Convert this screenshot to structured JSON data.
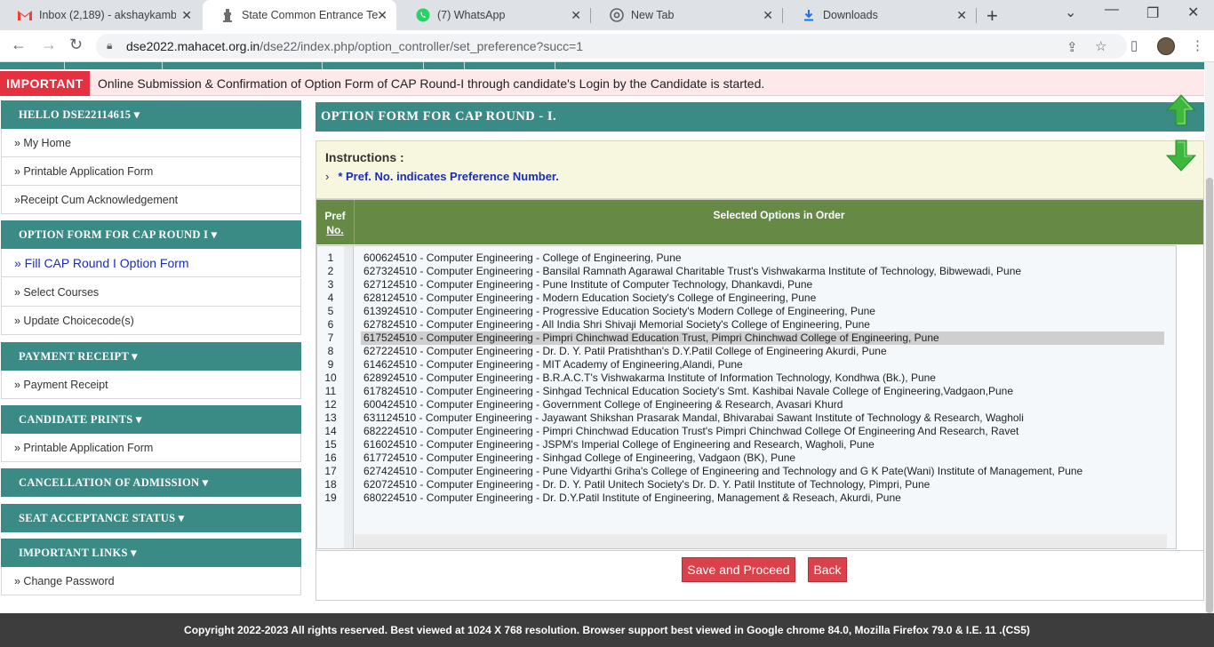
{
  "browser": {
    "tabs": [
      {
        "label": "Inbox (2,189) - akshaykamble",
        "icon": "gmail-icon",
        "active": false
      },
      {
        "label": "State Common Entrance Test",
        "icon": "emblem-icon",
        "active": true
      },
      {
        "label": "(7) WhatsApp",
        "icon": "whatsapp-icon",
        "active": false
      },
      {
        "label": "New Tab",
        "icon": "chrome-icon",
        "active": false
      },
      {
        "label": "Downloads",
        "icon": "download-icon",
        "active": false
      }
    ],
    "url_host": "dse2022.mahacet.org.in",
    "url_path": "/dse22/index.php/option_controller/set_preference?succ=1"
  },
  "notice": {
    "label": "IMPORTANT",
    "text": "Online Submission & Confirmation of Option Form of CAP Round-I through candidate's Login by the Candidate is started."
  },
  "sidebar": {
    "hello": "HELLO DSE22114615 ▾",
    "home_items": [
      "» My Home",
      "» Printable Application Form",
      "»Receipt Cum Acknowledgement"
    ],
    "option_head": "OPTION FORM FOR CAP ROUND I ▾",
    "option_items": [
      "» Fill CAP Round I Option Form",
      "» Select Courses",
      "» Update Choicecode(s)"
    ],
    "payment_head": "PAYMENT RECEIPT ▾",
    "payment_items": [
      "» Payment Receipt"
    ],
    "prints_head": "CANDIDATE PRINTS ▾",
    "prints_items": [
      "» Printable Application Form"
    ],
    "cancel_head": "CANCELLATION OF ADMISSION ▾",
    "seat_head": "SEAT ACCEPTANCE STATUS ▾",
    "links_head": "IMPORTANT LINKS ▾",
    "links_items": [
      "» Change Password"
    ]
  },
  "main": {
    "title": "OPTION FORM FOR CAP ROUND - I.",
    "instructions_title": "Instructions :",
    "instruction": "* Pref. No. indicates Preference Number.",
    "col_pref_1": "Pref",
    "col_pref_2": "No.",
    "col_selected": "Selected Options in Order",
    "selected_row": 7,
    "options": [
      "600624510 - Computer Engineering - College of Engineering, Pune",
      "627324510 - Computer Engineering - Bansilal Ramnath Agarawal Charitable Trust's Vishwakarma Institute of Technology, Bibwewadi, Pune",
      "627124510 - Computer Engineering - Pune Institute of Computer Technology, Dhankavdi, Pune",
      "628124510 - Computer Engineering - Modern Education Society's College of Engineering, Pune",
      "613924510 - Computer Engineering - Progressive Education Society's Modern College of Engineering, Pune",
      "627824510 - Computer Engineering - All India Shri Shivaji Memorial Society's College of Engineering, Pune",
      "617524510 - Computer Engineering - Pimpri Chinchwad Education Trust, Pimpri Chinchwad College of Engineering, Pune",
      "627224510 - Computer Engineering - Dr. D. Y. Patil Pratishthan's D.Y.Patil College of Engineering Akurdi, Pune",
      "614624510 - Computer Engineering - MIT Academy of Engineering,Alandi, Pune",
      "628924510 - Computer Engineering - B.R.A.C.T's Vishwakarma Institute of Information Technology, Kondhwa (Bk.), Pune",
      "617824510 - Computer Engineering - Sinhgad Technical Education Society's Smt. Kashibai Navale College of Engineering,Vadgaon,Pune",
      "600424510 - Computer Engineering - Government College of Engineering & Research, Avasari Khurd",
      "631124510 - Computer Engineering - Jayawant Shikshan Prasarak Mandal, Bhivarabai Sawant Institute of Technology & Research, Wagholi",
      "682224510 - Computer Engineering - Pimpri Chinchwad Education Trust's Pimpri Chinchwad College Of Engineering And Research, Ravet",
      "616024510 - Computer Engineering - JSPM's Imperial College of Engineering and Research, Wagholi, Pune",
      "617724510 - Computer Engineering - Sinhgad College of Engineering, Vadgaon (BK), Pune",
      "627424510 - Computer Engineering - Pune Vidyarthi Griha's College of Engineering and Technology and G K Pate(Wani) Institute of Management, Pune",
      "620724510 - Computer Engineering - Dr. D. Y. Patil Unitech Society's Dr. D. Y. Patil Institute of Technology, Pimpri, Pune",
      "680224510 - Computer Engineering - Dr. D.Y.Patil Institute of Engineering, Management & Reseach, Akurdi, Pune"
    ],
    "save_button": "Save and Proceed",
    "back_button": "Back"
  },
  "footer": "Copyright 2022-2023 All rights reserved. Best viewed at 1024 X 768 resolution. Browser support best viewed in Google chrome 84.0, Mozilla Firefox 79.0 & I.E. 11 .(CS5)"
}
